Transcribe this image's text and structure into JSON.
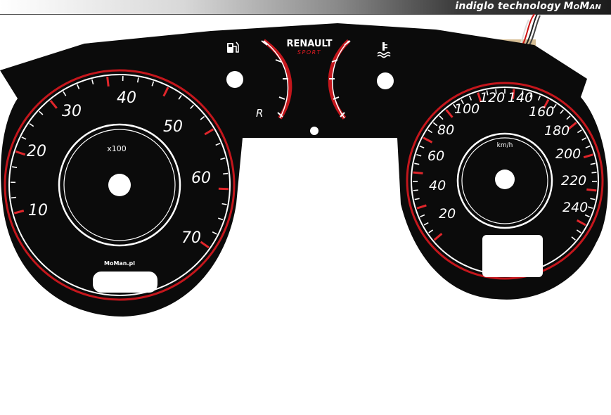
{
  "header": {
    "brand_text": "indiglo technology",
    "brand_name": "MoMan"
  },
  "colors": {
    "dial_face": "#0b0b0b",
    "ring_red": "#c4161c",
    "ring_white": "#ffffff",
    "ticks": "#ffffff"
  },
  "logo": {
    "title": "RENAULT",
    "subtitle": "SPORT"
  },
  "tachometer": {
    "labels": [
      "10",
      "20",
      "30",
      "40",
      "50",
      "60",
      "70"
    ],
    "unit": "x100",
    "maker": "MoMan.pl"
  },
  "speedometer": {
    "labels": [
      "20",
      "40",
      "60",
      "80",
      "100",
      "120",
      "140",
      "160",
      "180",
      "200",
      "220",
      "240"
    ],
    "unit": "km/h"
  },
  "fuel_gauge": {
    "icon": "fuel-pump-icon",
    "reserve_label": "R"
  },
  "temp_gauge": {
    "icon": "coolant-temperature-icon"
  }
}
